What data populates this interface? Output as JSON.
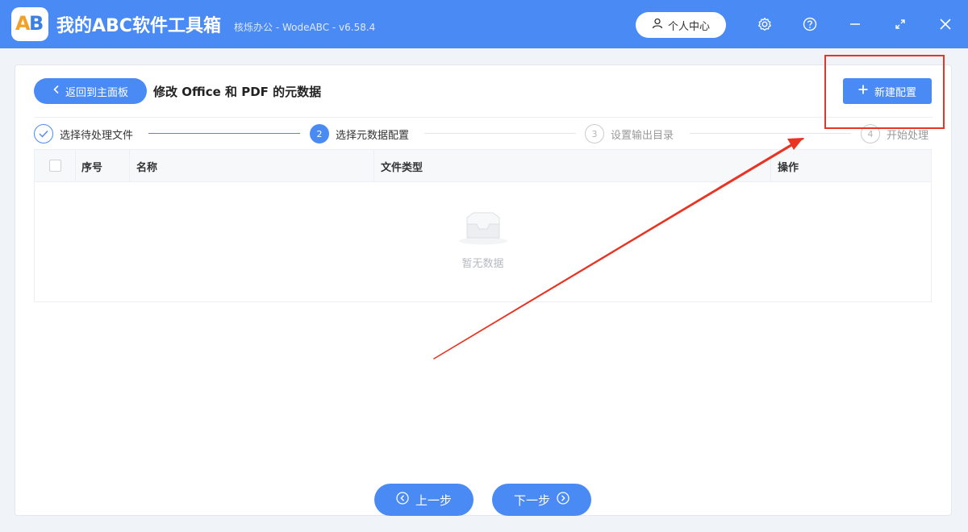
{
  "window": {
    "app_title": "我的ABC软件工具箱",
    "subtitle": "核烁办公 - WodeABC - v6.58.4",
    "logo_text_a": "A",
    "logo_text_b": "B",
    "user_center": "个人中心",
    "icons": [
      "user-icon",
      "gear-icon",
      "help-icon",
      "minimize-icon",
      "maximize-icon",
      "close-icon"
    ]
  },
  "header": {
    "back_label": "返回到主面板",
    "title": "修改 Office 和 PDF 的元数据",
    "new_config": "新建配置"
  },
  "steps": [
    {
      "number": "✓",
      "label": "选择待处理文件",
      "state": "done"
    },
    {
      "number": "2",
      "label": "选择元数据配置",
      "state": "active"
    },
    {
      "number": "3",
      "label": "设置输出目录",
      "state": "pending"
    },
    {
      "number": "4",
      "label": "开始处理",
      "state": "pending"
    }
  ],
  "table": {
    "columns": [
      "序号",
      "名称",
      "文件类型",
      "操作"
    ],
    "empty_text": "暂无数据"
  },
  "nav": {
    "prev": "上一步",
    "next": "下一步"
  },
  "colors": {
    "primary": "#4a8af4",
    "annotation": "#ea3323"
  }
}
